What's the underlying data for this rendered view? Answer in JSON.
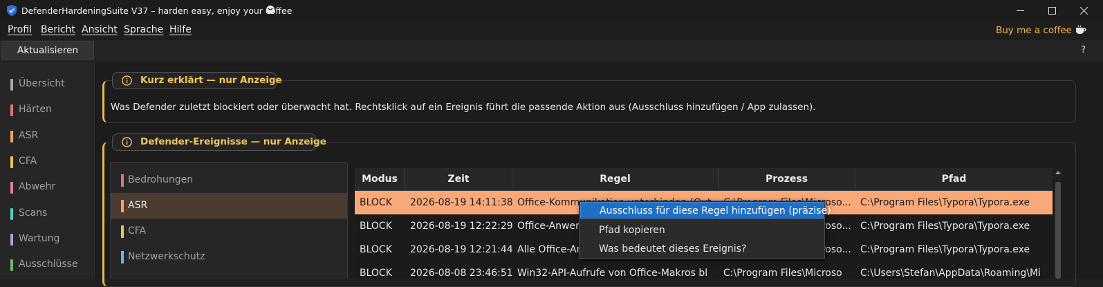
{
  "window": {
    "title": "DefenderHardeningSuite V37    –    harden easy, enjoy your coffee",
    "controls": [
      "minimize",
      "maximize",
      "close"
    ]
  },
  "menubar": {
    "items": [
      "Profil",
      "Bericht",
      "Ansicht",
      "Sprache",
      "Hilfe"
    ],
    "buy_coffee": "Buy me a coffee"
  },
  "toolbar": {
    "refresh_label": "Aktualisieren",
    "help_label": "?"
  },
  "sidebar": {
    "items": [
      {
        "label": "Übersicht",
        "color": "#a8a8a8"
      },
      {
        "label": "Härten",
        "color": "#e57373"
      },
      {
        "label": "ASR",
        "color": "#f4a261"
      },
      {
        "label": "CFA",
        "color": "#f2c14e"
      },
      {
        "label": "Abwehr",
        "color": "#e87a9a"
      },
      {
        "label": "Scans",
        "color": "#4fd1c5"
      },
      {
        "label": "Wartung",
        "color": "#b39ddb"
      },
      {
        "label": "Ausschlüsse",
        "color": "#66bb6a"
      }
    ]
  },
  "info_box": {
    "header": "Kurz erklärt — nur Anzeige",
    "text": "Was Defender zuletzt blockiert oder überwacht hat. Rechtsklick auf ein Ereignis führt die passende Aktion aus (Ausschluss hinzufügen / App zulassen)."
  },
  "events_box": {
    "header": "Defender-Ereignisse — nur Anzeige",
    "categories": [
      {
        "label": "Bedrohungen",
        "color": "#e57373",
        "selected": false
      },
      {
        "label": "ASR",
        "color": "#f4a261",
        "selected": true
      },
      {
        "label": "CFA",
        "color": "#f2c14e",
        "selected": false
      },
      {
        "label": "Netzwerkschutz",
        "color": "#64b5f6",
        "selected": false
      }
    ],
    "table": {
      "columns": [
        "Modus",
        "Zeit",
        "Regel",
        "Prozess",
        "Pfad"
      ],
      "rows": [
        [
          "BLOCK",
          "2026-08-19 14:11:38",
          "Office-Kommunikation unterbinden (Out",
          "C:\\Program Files\\Microso...",
          "C:\\Program Files\\Typora\\Typora.exe"
        ],
        [
          "BLOCK",
          "2026-08-19 12:22:29",
          "Office-Anwendungen am Erstellen",
          "C:\\Program Files\\Microso...",
          "C:\\Program Files\\Typora\\Typora.exe"
        ],
        [
          "BLOCK",
          "2026-08-19 12:21:44",
          "Alle Office-Anwendungen",
          "C:\\Program Files\\Microso...",
          "C:\\Program Files\\Typora\\Typora.exe"
        ],
        [
          "BLOCK",
          "2026-08-08 23:46:51",
          "Win32-API-Aufrufe von Office-Makros bl",
          "C:\\Program Files\\Microso",
          "C:\\Users\\Stefan\\AppData\\Roaming\\Mi"
        ]
      ]
    },
    "context_menu": {
      "items": [
        "Ausschluss für diese Regel hinzufügen (präzise)",
        "Pfad kopieren",
        "Was bedeutet dieses Ereignis?"
      ]
    }
  },
  "colors": {
    "accent": "#e9b949",
    "selected_row": "#f9a877",
    "context_highlight": "#1f6fc4",
    "buy_coffee": "#f0b94b"
  }
}
